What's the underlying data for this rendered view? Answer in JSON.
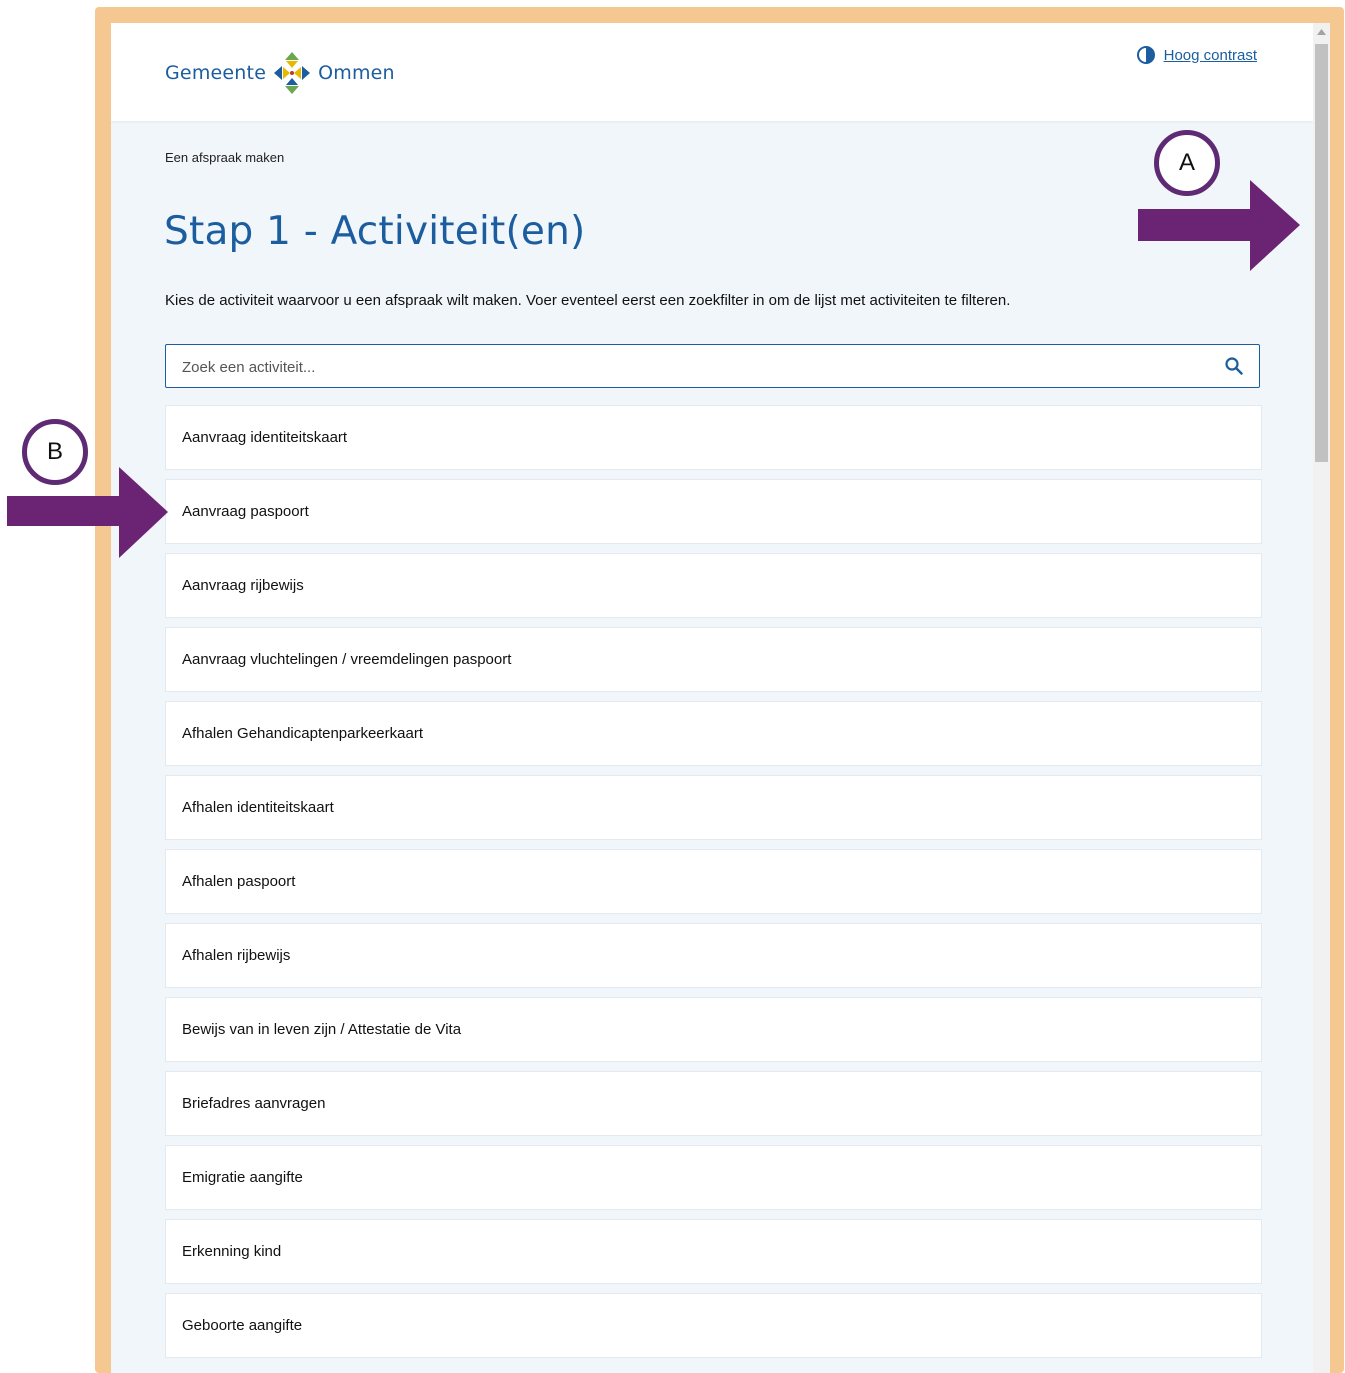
{
  "header": {
    "logo_left": "Gemeente",
    "logo_right": "Ommen",
    "contrast_label": "Hoog contrast"
  },
  "breadcrumb": "Een afspraak maken",
  "title": "Stap 1 - Activiteit(en)",
  "intro": "Kies de activiteit waarvoor u een afspraak wilt maken. Voer eventeel eerst een zoekfilter in om de lijst met activiteiten te filteren.",
  "search": {
    "placeholder": "Zoek een activiteit..."
  },
  "activities": [
    "Aanvraag identiteitskaart",
    "Aanvraag paspoort",
    "Aanvraag rijbewijs",
    "Aanvraag vluchtelingen / vreemdelingen paspoort",
    "Afhalen Gehandicaptenparkeerkaart",
    "Afhalen identiteitskaart",
    "Afhalen paspoort",
    "Afhalen rijbewijs",
    "Bewijs van in leven zijn / Attestatie de Vita",
    "Briefadres aanvragen",
    "Emigratie aangifte",
    "Erkenning kind",
    "Geboorte aangifte"
  ],
  "annotations": {
    "a": "A",
    "b": "B"
  },
  "colors": {
    "accent": "#1b5d9e",
    "frame": "#f5c892",
    "annotation": "#6b2473",
    "background": "#f1f6fa"
  }
}
